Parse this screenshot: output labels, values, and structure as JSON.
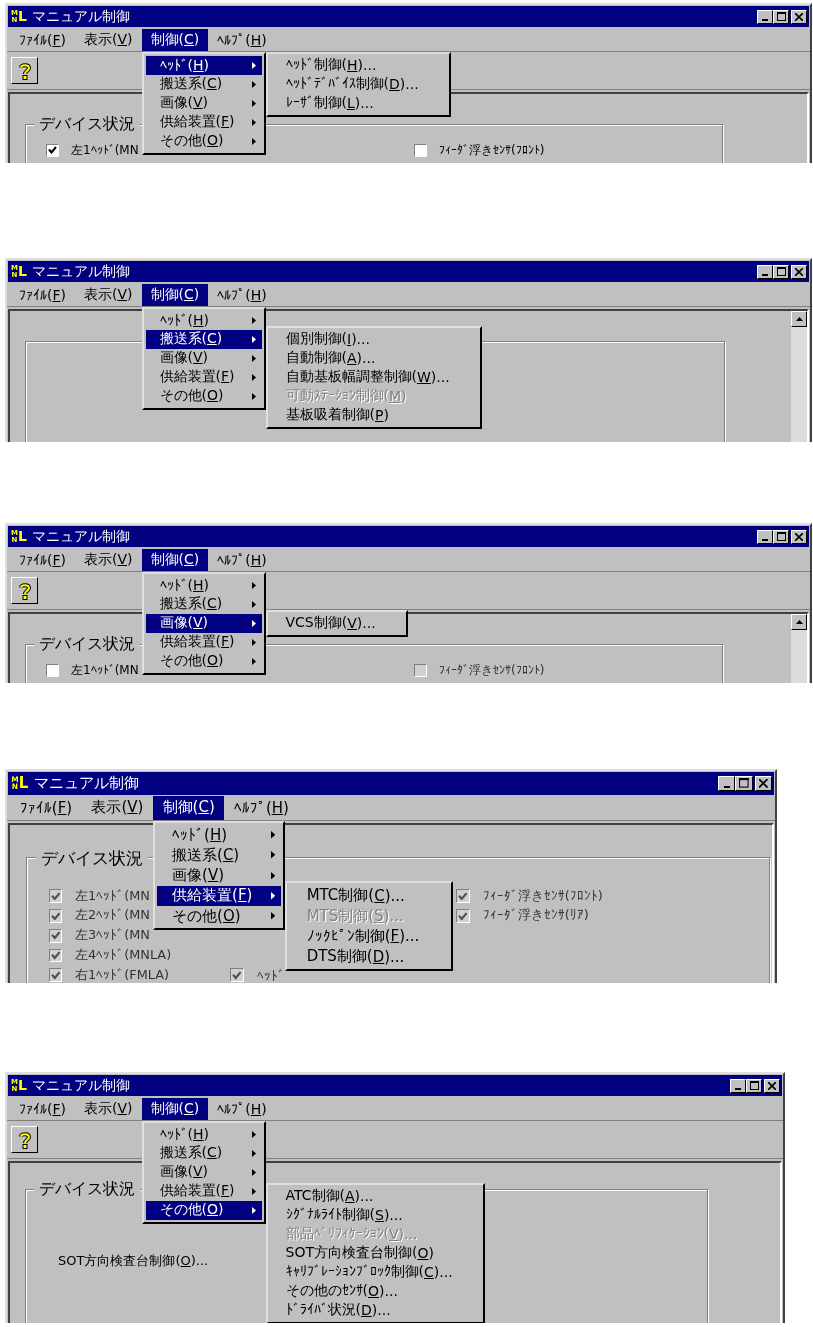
{
  "panels": [
    {
      "title": "マニュアル制御",
      "logo": "MNL",
      "menu_bar": [
        {
          "label": "ﾌｧｲﾙ(F)",
          "selected": false
        },
        {
          "label": "表示(V)",
          "selected": false
        },
        {
          "label": "制御(C)",
          "selected": true
        },
        {
          "label": "ﾍﾙﾌﾟ(H)",
          "selected": false
        }
      ],
      "dropdown": [
        {
          "label": "ﾍｯﾄﾞ(H)",
          "selected": true
        },
        {
          "label": "搬送系(C)",
          "selected": false
        },
        {
          "label": "画像(V)",
          "selected": false
        },
        {
          "label": "供給装置(F)",
          "selected": false
        },
        {
          "label": "その他(O)",
          "selected": false
        }
      ],
      "submenu": [
        {
          "label": "ﾍｯﾄﾞ制御(H)...",
          "disabled": false
        },
        {
          "label": "ﾍｯﾄﾞﾃﾞﾊﾞｲｽ制御(D)...",
          "disabled": false
        },
        {
          "label": "ﾚｰｻﾞ制御(L)...",
          "disabled": false
        }
      ],
      "toolbar": true,
      "scrollbar": false,
      "group": {
        "kind": "group_box",
        "label": "デバイス状況",
        "columns": [
          [
            {
              "kind": "checkbox",
              "label": "左1ﾍｯﾄﾞ(MN",
              "checked": true,
              "disabled": false
            }
          ],
          [],
          [
            {
              "kind": "checkbox",
              "label": "ﾌｨｰﾀﾞ浮きｾﾝｻ(ﾌﾛﾝﾄ)",
              "checked": false,
              "disabled": false
            }
          ]
        ]
      }
    },
    {
      "title": "マニュアル制御",
      "logo": "MNL",
      "menu_bar": [
        {
          "label": "ﾌｧｲﾙ(F)",
          "selected": false
        },
        {
          "label": "表示(V)",
          "selected": false
        },
        {
          "label": "制御(C)",
          "selected": true
        },
        {
          "label": "ﾍﾙﾌﾟ(H)",
          "selected": false
        }
      ],
      "dropdown": [
        {
          "label": "ﾍｯﾄﾞ(H)",
          "selected": false
        },
        {
          "label": "搬送系(C)",
          "selected": true
        },
        {
          "label": "画像(V)",
          "selected": false
        },
        {
          "label": "供給装置(F)",
          "selected": false
        },
        {
          "label": "その他(O)",
          "selected": false
        }
      ],
      "submenu": [
        {
          "label": "個別制御(I)...",
          "disabled": false
        },
        {
          "label": "自動制御(A)...",
          "disabled": false
        },
        {
          "label": "自動基板幅調整制御(W)...",
          "disabled": false
        },
        {
          "label": "可動ｽﾃｰｼｮﾝ制御(M)",
          "disabled": true
        },
        {
          "label": "基板吸着制御(P)",
          "disabled": false
        }
      ],
      "toolbar": false,
      "scrollbar": true,
      "group": {
        "kind": "group_box"
      }
    },
    {
      "title": "マニュアル制御",
      "logo": "MNL",
      "menu_bar": [
        {
          "label": "ﾌｧｲﾙ(F)",
          "selected": false
        },
        {
          "label": "表示(V)",
          "selected": false
        },
        {
          "label": "制御(C)",
          "selected": true
        },
        {
          "label": "ﾍﾙﾌﾟ(H)",
          "selected": false
        }
      ],
      "dropdown": [
        {
          "label": "ﾍｯﾄﾞ(H)",
          "selected": false
        },
        {
          "label": "搬送系(C)",
          "selected": false
        },
        {
          "label": "画像(V)",
          "selected": true
        },
        {
          "label": "供給装置(F)",
          "selected": false
        },
        {
          "label": "その他(O)",
          "selected": false
        }
      ],
      "submenu": [
        {
          "label": "VCS制御(V)...",
          "disabled": false
        }
      ],
      "toolbar": true,
      "scrollbar": true,
      "group": {
        "kind": "group_box",
        "label": "デバイス状況",
        "columns": [
          [
            {
              "kind": "checkbox",
              "label": "左1ﾍｯﾄﾞ(MN",
              "checked": false,
              "disabled": false
            }
          ],
          [],
          [
            {
              "kind": "checkbox",
              "label": "ﾌｨｰﾀﾞ浮きｾﾝｻ(ﾌﾛﾝﾄ)",
              "checked": false,
              "disabled": true
            }
          ]
        ]
      }
    },
    {
      "title": "マニュアル制御",
      "logo": "MNL",
      "menu_bar": [
        {
          "label": "ﾌｧｲﾙ(F)",
          "selected": false
        },
        {
          "label": "表示(V)",
          "selected": false
        },
        {
          "label": "制御(C)",
          "selected": true
        },
        {
          "label": "ﾍﾙﾌﾟ(H)",
          "selected": false
        }
      ],
      "dropdown": [
        {
          "label": "ﾍｯﾄﾞ(H)",
          "selected": false
        },
        {
          "label": "搬送系(C)",
          "selected": false
        },
        {
          "label": "画像(V)",
          "selected": false
        },
        {
          "label": "供給装置(F)",
          "selected": true
        },
        {
          "label": "その他(O)",
          "selected": false
        }
      ],
      "submenu": [
        {
          "label": "MTC制御(C)...",
          "disabled": false
        },
        {
          "label": "MTS制御(S)...",
          "disabled": true
        },
        {
          "label": "ﾉｯｸﾋﾟﾝ制御(F)...",
          "disabled": false
        },
        {
          "label": "DTS制御(D)...",
          "disabled": false
        }
      ],
      "toolbar": false,
      "scrollbar": false,
      "group": {
        "kind": "group_box",
        "label": "デバイス状況",
        "columns": [
          [
            {
              "kind": "checkbox",
              "label": "左1ﾍｯﾄﾞ(MN",
              "checked": true,
              "disabled": true
            },
            {
              "kind": "checkbox",
              "label": "左2ﾍｯﾄﾞ(MN",
              "checked": true,
              "disabled": true
            },
            {
              "kind": "checkbox",
              "label": "左3ﾍｯﾄﾞ(MN",
              "checked": true,
              "disabled": true
            },
            {
              "kind": "checkbox",
              "label": "左4ﾍｯﾄﾞ(MNLA)",
              "checked": true,
              "disabled": true
            },
            {
              "kind": "checkbox",
              "label": "右1ﾍｯﾄﾞ(FMLA)",
              "checked": true,
              "disabled": true
            }
          ],
          [
            {
              "kind": "checkbox",
              "label": "ﾍｯﾄﾞ",
              "checked": true,
              "disabled": true
            }
          ],
          [
            {
              "kind": "checkbox",
              "label": "ﾌｨｰﾀﾞ浮きｾﾝｻ(ﾌﾛﾝﾄ)",
              "checked": true,
              "disabled": true
            },
            {
              "kind": "checkbox",
              "label": "ﾌｨｰﾀﾞ浮きｾﾝｻ(ﾘｱ)",
              "checked": true,
              "disabled": true
            }
          ]
        ]
      }
    },
    {
      "title": "マニュアル制御",
      "logo": "MNL",
      "menu_bar": [
        {
          "label": "ﾌｧｲﾙ(F)",
          "selected": false
        },
        {
          "label": "表示(V)",
          "selected": false
        },
        {
          "label": "制御(C)",
          "selected": true
        },
        {
          "label": "ﾍﾙﾌﾟ(H)",
          "selected": false
        }
      ],
      "dropdown": [
        {
          "label": "ﾍｯﾄﾞ(H)",
          "selected": false
        },
        {
          "label": "搬送系(C)",
          "selected": false
        },
        {
          "label": "画像(V)",
          "selected": false
        },
        {
          "label": "供給装置(F)",
          "selected": false
        },
        {
          "label": "その他(O)",
          "selected": true
        }
      ],
      "submenu": [
        {
          "label": "ATC制御(A)...",
          "disabled": false
        },
        {
          "label": "ｼｸﾞﾅﾙﾗｲﾄ制御(S)...",
          "disabled": false
        },
        {
          "label": "部品ﾍﾞﾘﾌｨｹｰｼｮﾝ(V)...",
          "disabled": true
        },
        {
          "label": "SOT方向検査台制御(O)",
          "disabled": false
        },
        {
          "label": "ｷｬﾘﾌﾞﾚｰｼｮﾝﾌﾞﾛｯｸ制御(C)...",
          "disabled": false
        },
        {
          "label": "その他のｾﾝｻ(O)...",
          "disabled": false
        },
        {
          "label": "ﾄﾞﾗｲﾊﾞ状況(D)...",
          "disabled": false
        }
      ],
      "toolbar": true,
      "scrollbar": false,
      "group": {
        "kind": "group_box",
        "label": "デバイス状況",
        "columns": [
          [
            {
              "kind": "label",
              "label": "SOT方向検査台制御(O)..."
            }
          ]
        ]
      }
    }
  ]
}
